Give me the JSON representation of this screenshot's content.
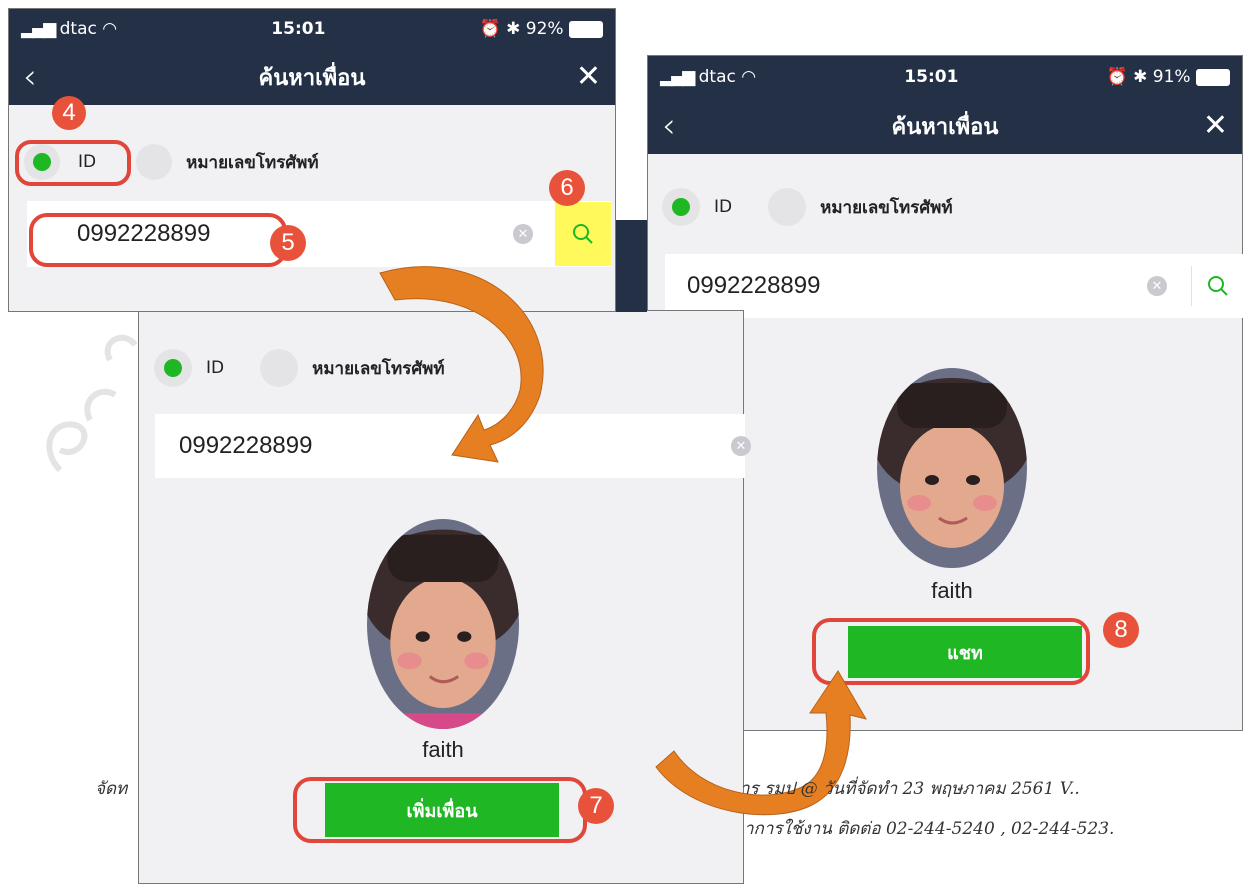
{
  "screens": {
    "first": {
      "carrier": "dtac",
      "time": "15:01",
      "battery": "92%",
      "title": "ค้นหาเพื่อน",
      "radio_id": "ID",
      "radio_phone": "หมายเลขโทรศัพท์",
      "input_value": "0992228899"
    },
    "second": {
      "radio_id": "ID",
      "radio_phone": "หมายเลขโทรศัพท์",
      "input_value": "0992228899",
      "profile_name": "faith",
      "add_button": "เพิ่มเพื่อน"
    },
    "third": {
      "carrier": "dtac",
      "time": "15:01",
      "battery": "91%",
      "title": "ค้นหาเพื่อน",
      "radio_id": "ID",
      "radio_phone": "หมายเลขโทรศัพท์",
      "input_value": "0992228899",
      "profile_name": "faith",
      "chat_button": "แชท"
    }
  },
  "steps": {
    "s4": "4",
    "s5": "5",
    "s6": "6",
    "s7": "7",
    "s8": "8"
  },
  "footer": {
    "line1_left": "จัดท",
    "line1_right": "าร รมป    @ วันที่จัดทำ  23 พฤษภาคม 2561  V..",
    "line2_right": "าการใช้งาน ติดต่อ  02-244-5240 , 02-244-523."
  },
  "colors": {
    "navy": "#233046",
    "green": "#1fb824",
    "badge_red": "#e8523b",
    "arrow_orange": "#e67e22",
    "highlight_yellow": "#fff95b"
  }
}
